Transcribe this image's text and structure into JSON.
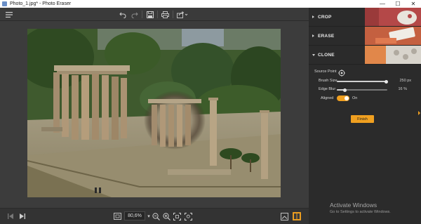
{
  "window": {
    "title": "Photo_1.jpg* - Photo Eraser",
    "minimize_glyph": "—",
    "maximize_glyph": "☐",
    "close_glyph": "✕"
  },
  "toolbar": {
    "menu_icon": "hamburger-menu-icon",
    "undo_icon": "undo-icon",
    "redo_icon": "redo-icon",
    "save_icon": "save-icon",
    "print_icon": "print-icon",
    "share_icon": "share-icon"
  },
  "bottom_bar": {
    "zoom_value": "80,6%",
    "zoom_dropdown_glyph": "▾"
  },
  "panel": {
    "sections": [
      {
        "label": "CROP",
        "expanded": false
      },
      {
        "label": "ERASE",
        "expanded": false
      },
      {
        "label": "CLONE",
        "expanded": true
      }
    ],
    "clone": {
      "source_point_label": "Source Point",
      "brush_size_label": "Brush Size",
      "brush_size_value": "250 px",
      "brush_size_fraction": 0.98,
      "edge_blur_label": "Edge Blur",
      "edge_blur_value": "16 %",
      "edge_blur_fraction": 0.16,
      "aligned_label": "Aligned",
      "aligned_state": "On",
      "finish_label": "Finish"
    }
  },
  "activation": {
    "line1": "Activate Windows",
    "line2": "Go to Settings to activate Windows."
  },
  "colors": {
    "accent": "#f0a020",
    "panel_bg": "#2b2b2b",
    "toolbar_bg": "#3a3a3a"
  }
}
